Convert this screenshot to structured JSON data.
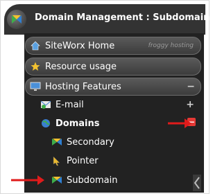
{
  "header": {
    "title": "Domain Management : Subdomains"
  },
  "menu": {
    "home": {
      "label": "SiteWorx Home",
      "watermark": "froggy hosting"
    },
    "resource": {
      "label": "Resource usage"
    },
    "hosting": {
      "label": "Hosting Features",
      "toggle": "−"
    },
    "email": {
      "label": "E-mail",
      "toggle": "+"
    },
    "domains": {
      "label": "Domains",
      "toggle": "−"
    },
    "secondary": {
      "label": "Secondary"
    },
    "pointer": {
      "label": "Pointer"
    },
    "subdomain": {
      "label": "Subdomain"
    }
  },
  "colors": {
    "header_bg": "#333333",
    "panel_bg": "#222222",
    "annotation_red": "#e01b1b",
    "toggle_red": "#e53935"
  }
}
